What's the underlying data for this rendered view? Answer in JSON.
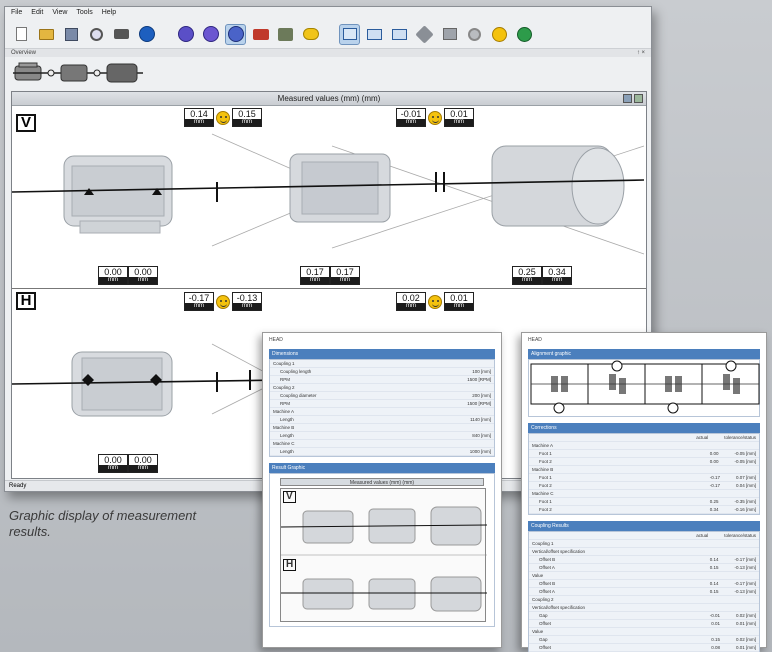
{
  "app": {
    "menu": [
      "File",
      "Edit",
      "View",
      "Tools",
      "Help"
    ],
    "overview_label": "Overview",
    "overview_pin": "↑ ×",
    "status": "Ready",
    "toolbar_icons": [
      "new-doc-icon",
      "open-folder-icon",
      "save-icon",
      "print-preview-icon",
      "print-icon",
      "info-icon",
      "machine-a-icon",
      "machine-b-icon",
      "machine-c-icon",
      "coupling-icon",
      "motor-icon",
      "soft-foot-icon",
      "view-side-icon",
      "view-top-icon",
      "view-3d-icon",
      "wrench-icon",
      "table-icon",
      "settings-icon",
      "smiley-icon",
      "globe-icon"
    ]
  },
  "pane": {
    "title": "Measured values (mm) (mm)",
    "vertical_label": "V",
    "horizontal_label": "H",
    "unit": "mm",
    "v_top_left": [
      "0.14",
      "0.15"
    ],
    "v_top_right": [
      "-0.01",
      "0.01"
    ],
    "v_bottom": [
      [
        "0.00",
        "0.00"
      ],
      [
        "0.17",
        "0.17"
      ],
      [
        "0.25",
        "0.34"
      ]
    ],
    "h_top_left": [
      "-0.17",
      "-0.13"
    ],
    "h_top_right": [
      "0.02",
      "0.01"
    ],
    "h_bottom": [
      [
        "0.00",
        "0.00"
      ]
    ]
  },
  "caption": "Graphic display of measurement results.",
  "report_left": {
    "header": "HEAD",
    "section1": "Dimensions",
    "rows": [
      {
        "label": "Coupling 1",
        "value": "",
        "indent": false
      },
      {
        "label": "Coupling length",
        "value": "100 [mm]",
        "indent": true
      },
      {
        "label": "RPM",
        "value": "1500 [RPM]",
        "indent": true
      },
      {
        "label": "Coupling 2",
        "value": "",
        "indent": false
      },
      {
        "label": "Coupling diameter",
        "value": "200 [mm]",
        "indent": true
      },
      {
        "label": "RPM",
        "value": "1500 [RPM]",
        "indent": true
      },
      {
        "label": "Machine A",
        "value": "",
        "indent": false
      },
      {
        "label": "Length",
        "value": "1140 [mm]",
        "indent": true
      },
      {
        "label": "Machine B",
        "value": "",
        "indent": false
      },
      {
        "label": "Length",
        "value": "840 [mm]",
        "indent": true
      },
      {
        "label": "Machine C",
        "value": "",
        "indent": false
      },
      {
        "label": "Length",
        "value": "1000 [mm]",
        "indent": true
      }
    ],
    "section2": "Result Graphic",
    "mini_title": "Measured values (mm) (mm)",
    "mini_v": "V",
    "mini_h": "H"
  },
  "report_right": {
    "header": "HEAD",
    "section1": "Alignment graphic",
    "section2": "Corrections",
    "col_actual": "actual",
    "col_tol": "tolerance/status",
    "corrections": [
      {
        "label": "Machine A",
        "a": "",
        "b": "",
        "indent": false
      },
      {
        "label": "Foot 1",
        "a": "0.00",
        "b": "-0.05 [mm]",
        "indent": true
      },
      {
        "label": "Foot 2",
        "a": "0.00",
        "b": "-0.05 [mm]",
        "indent": true
      },
      {
        "label": "Machine B",
        "a": "",
        "b": "",
        "indent": false
      },
      {
        "label": "Foot 1",
        "a": "-0.17",
        "b": "0.07 [mm]",
        "indent": true
      },
      {
        "label": "Foot 2",
        "a": "-0.17",
        "b": "0.04 [mm]",
        "indent": true
      },
      {
        "label": "Machine C",
        "a": "",
        "b": "",
        "indent": false
      },
      {
        "label": "Foot 1",
        "a": "0.25",
        "b": "-0.35 [mm]",
        "indent": true
      },
      {
        "label": "Foot 2",
        "a": "0.34",
        "b": "-0.16 [mm]",
        "indent": true
      }
    ],
    "section3": "Coupling Results",
    "coupling": [
      {
        "label": "Coupling 1",
        "a": "",
        "b": "",
        "indent": false
      },
      {
        "label": "Vertical/offset specification",
        "a": "",
        "b": "",
        "indent": false
      },
      {
        "label": "Offset B",
        "a": "0.14",
        "b": "-0.17 [mm]",
        "indent": true
      },
      {
        "label": "Offset A",
        "a": "0.15",
        "b": "-0.13 [mm]",
        "indent": true
      },
      {
        "label": "Value",
        "a": "",
        "b": "",
        "indent": false
      },
      {
        "label": "Offset B",
        "a": "0.14",
        "b": "-0.17 [mm]",
        "indent": true
      },
      {
        "label": "Offset A",
        "a": "0.15",
        "b": "-0.13 [mm]",
        "indent": true
      },
      {
        "label": "Coupling 2",
        "a": "",
        "b": "",
        "indent": false
      },
      {
        "label": "Vertical/offset specification",
        "a": "",
        "b": "",
        "indent": false
      },
      {
        "label": "Gap",
        "a": "-0.01",
        "b": "0.02 [mm]",
        "indent": true
      },
      {
        "label": "Offset",
        "a": "0.01",
        "b": "0.01 [mm]",
        "indent": true
      },
      {
        "label": "Value",
        "a": "",
        "b": "",
        "indent": false
      },
      {
        "label": "Gap",
        "a": "0.15",
        "b": "0.02 [mm]",
        "indent": true
      },
      {
        "label": "Offset",
        "a": "0.08",
        "b": "0.01 [mm]",
        "indent": true
      }
    ]
  }
}
